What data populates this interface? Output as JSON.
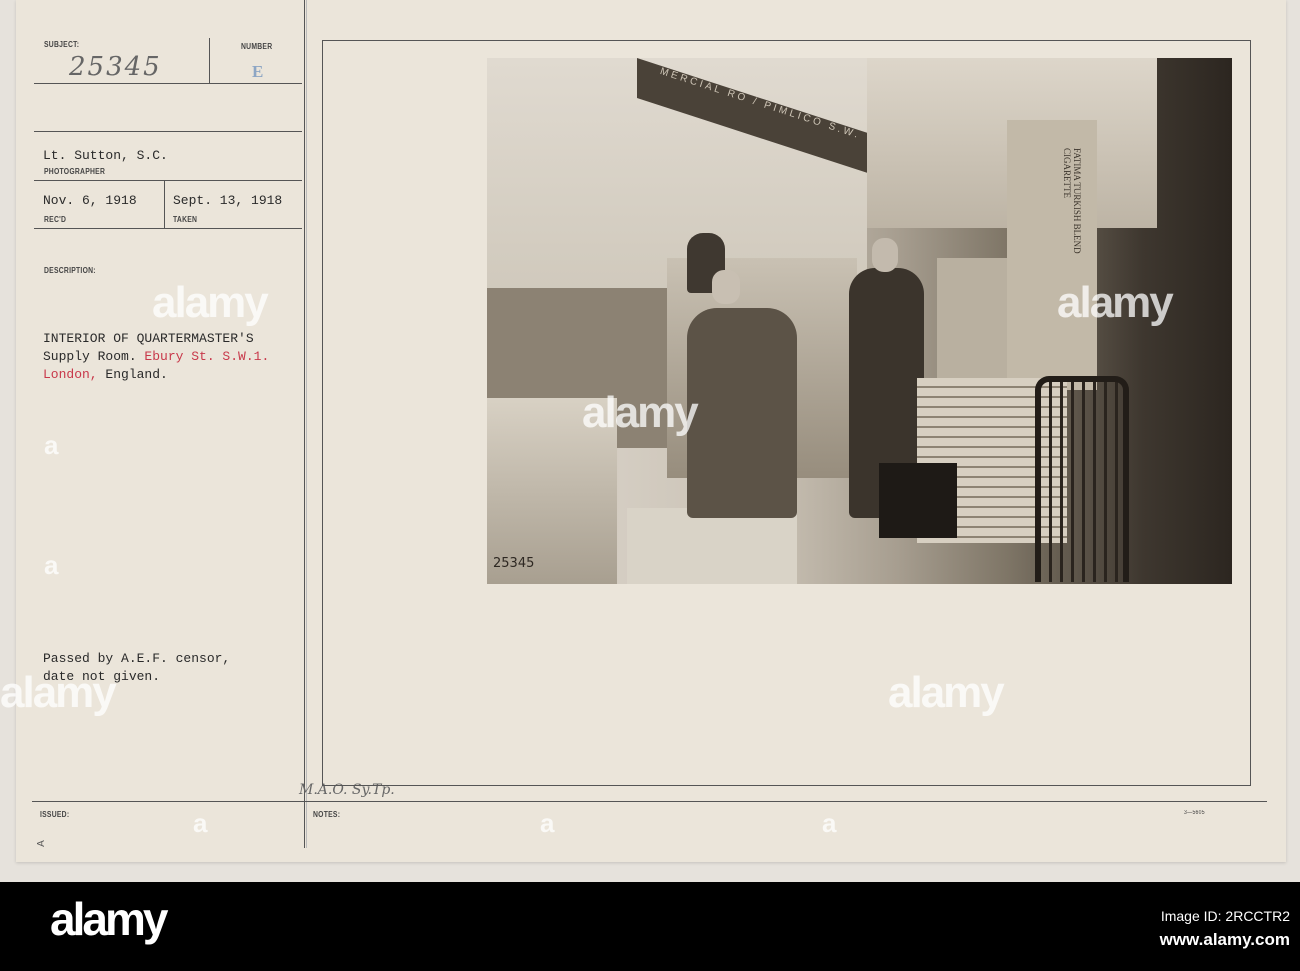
{
  "card": {
    "subject_label": "SUBJECT:",
    "subject_number": "25345",
    "number_label": "NUMBER",
    "number_stamp": "E",
    "photographer": "Lt. Sutton, S.C.",
    "photographer_label": "PHOTOGRAPHER",
    "received": "Nov. 6, 1918",
    "received_label": "REC'D",
    "taken": "Sept. 13, 1918",
    "taken_label": "TAKEN",
    "description_label": "DESCRIPTION:",
    "description": {
      "line1": "INTERIOR OF QUARTERMASTER'S",
      "line2_black": "Supply Room. ",
      "line2_red": "Ebury St. S.W.1.",
      "line3_red": "London,",
      "line3_black": " England."
    },
    "censor_line1": "Passed by A.E.F. censor,",
    "censor_line2": "date not given.",
    "issued_label": "ISSUED:",
    "notes_label": "NOTES:",
    "notes_handwritten": "M.A.O. Sy.Tp.",
    "form_number": "3—5605",
    "corner_mark": "A"
  },
  "photo": {
    "negative_number": "25345",
    "sign_text": "MERCIAL RO / PIMLICO S.W.",
    "crate_text": "FATIMA TURKISH BLEND CIGARETTE"
  },
  "watermark": {
    "brand": "alamy",
    "small": "a"
  },
  "footer": {
    "logo": "alamy",
    "image_id": "Image ID: 2RCCTR2",
    "url": "www.alamy.com"
  },
  "colors": {
    "paper": "#ebe5da",
    "red_type": "#c8384a",
    "footer": "#000000"
  }
}
